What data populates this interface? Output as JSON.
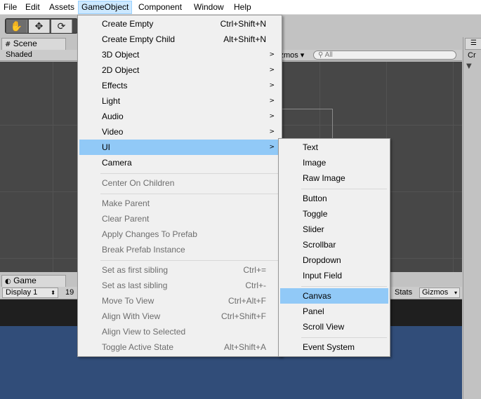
{
  "menubar": [
    "File",
    "Edit",
    "Assets",
    "GameObject",
    "Component",
    "Window",
    "Help"
  ],
  "toolbar": {
    "tools": [
      "hand-tool",
      "move-tool",
      "rotate-tool"
    ],
    "tool_glyphs": [
      "✋",
      "✥",
      "⟳"
    ]
  },
  "scene": {
    "tab": "Scene",
    "shaded": "Shaded",
    "gizmos": "izmos ▾",
    "search_placeholder": "All"
  },
  "right_panel": {
    "label": "Cr"
  },
  "game": {
    "tab": "Game",
    "display": "Display 1",
    "resolution": "19",
    "stats": "Stats",
    "gizmos": "Gizmos"
  },
  "gameobject_menu": {
    "items": [
      {
        "label": "Create Empty",
        "shortcut": "Ctrl+Shift+N"
      },
      {
        "label": "Create Empty Child",
        "shortcut": "Alt+Shift+N"
      },
      {
        "label": "3D Object",
        "submenu": true
      },
      {
        "label": "2D Object",
        "submenu": true
      },
      {
        "label": "Effects",
        "submenu": true
      },
      {
        "label": "Light",
        "submenu": true
      },
      {
        "label": "Audio",
        "submenu": true
      },
      {
        "label": "Video",
        "submenu": true
      },
      {
        "label": "UI",
        "submenu": true,
        "highlighted": true
      },
      {
        "label": "Camera"
      },
      {
        "label": "Center On Children",
        "disabled": true
      },
      {
        "label": "Make Parent",
        "disabled": true
      },
      {
        "label": "Clear Parent",
        "disabled": true
      },
      {
        "label": "Apply Changes To Prefab",
        "disabled": true
      },
      {
        "label": "Break Prefab Instance",
        "disabled": true
      },
      {
        "label": "Set as first sibling",
        "shortcut": "Ctrl+=",
        "disabled": true
      },
      {
        "label": "Set as last sibling",
        "shortcut": "Ctrl+-",
        "disabled": true
      },
      {
        "label": "Move To View",
        "shortcut": "Ctrl+Alt+F",
        "disabled": true
      },
      {
        "label": "Align With View",
        "shortcut": "Ctrl+Shift+F",
        "disabled": true
      },
      {
        "label": "Align View to Selected",
        "disabled": true
      },
      {
        "label": "Toggle Active State",
        "shortcut": "Alt+Shift+A",
        "disabled": true
      }
    ]
  },
  "ui_submenu": {
    "items": [
      {
        "label": "Text"
      },
      {
        "label": "Image"
      },
      {
        "label": "Raw Image"
      },
      {
        "label": "Button"
      },
      {
        "label": "Toggle"
      },
      {
        "label": "Slider"
      },
      {
        "label": "Scrollbar"
      },
      {
        "label": "Dropdown"
      },
      {
        "label": "Input Field"
      },
      {
        "label": "Canvas",
        "highlighted": true
      },
      {
        "label": "Panel"
      },
      {
        "label": "Scroll View"
      },
      {
        "label": "Event System"
      }
    ]
  },
  "colors": {
    "highlight": "#91c9f7",
    "menubar_active": "#cce8ff",
    "game_view": "#314d79",
    "scene_view": "#474747"
  }
}
